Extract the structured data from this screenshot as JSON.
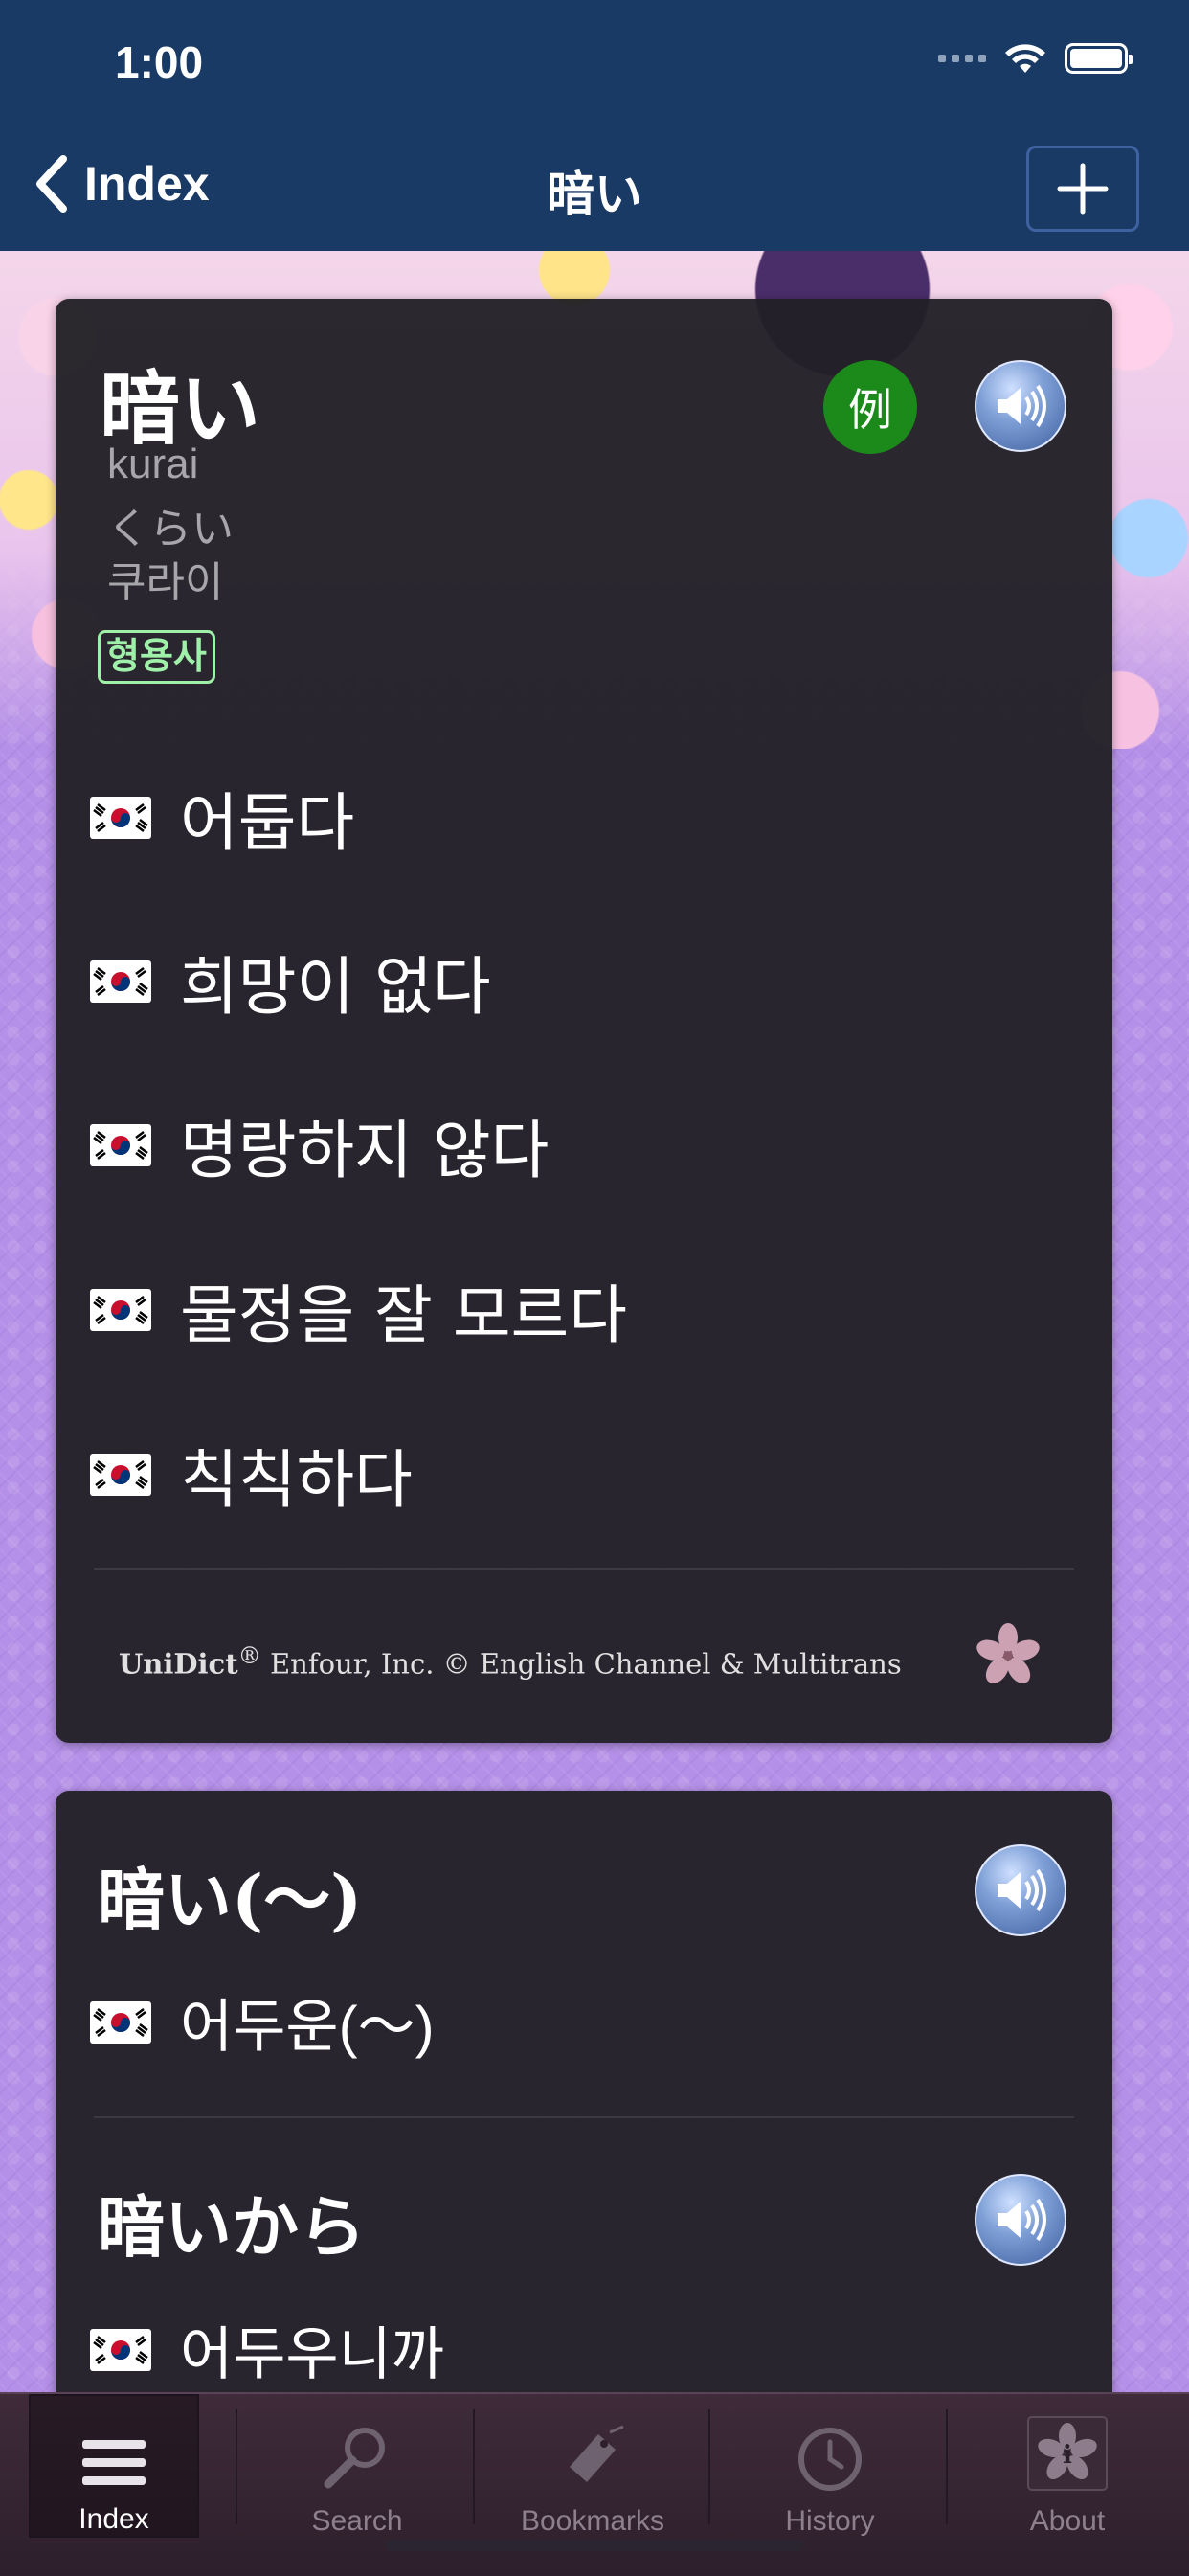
{
  "status_bar": {
    "time": "1:00"
  },
  "nav": {
    "back_label": "Index",
    "title": "暗い"
  },
  "entry": {
    "headword": "暗い",
    "romaji": "kurai",
    "kana": "くらい",
    "hangul_reading": "쿠라이",
    "pos": "형용사",
    "example_label": "例",
    "meanings": [
      "어둡다",
      "희망이 없다",
      "명랑하지 않다",
      "물정을 잘 모르다",
      "칙칙하다"
    ]
  },
  "credit": {
    "brand": "UniDict",
    "reg": "®",
    "text": " Enfour, Inc. © English Channel & Multitrans"
  },
  "phrases": [
    {
      "headword": "暗い(〜)",
      "translation": "어두운(〜)"
    },
    {
      "headword": "暗いから",
      "translation": "어두우니까"
    }
  ],
  "tabs": {
    "index": "Index",
    "search": "Search",
    "bookmarks": "Bookmarks",
    "history": "History",
    "about": "About"
  },
  "colors": {
    "nav_bar": "#1a3a66",
    "card": "#222026",
    "pos_badge": "#9ff0a8",
    "example_button": "#1b8a1b",
    "background": "#b590e8"
  }
}
